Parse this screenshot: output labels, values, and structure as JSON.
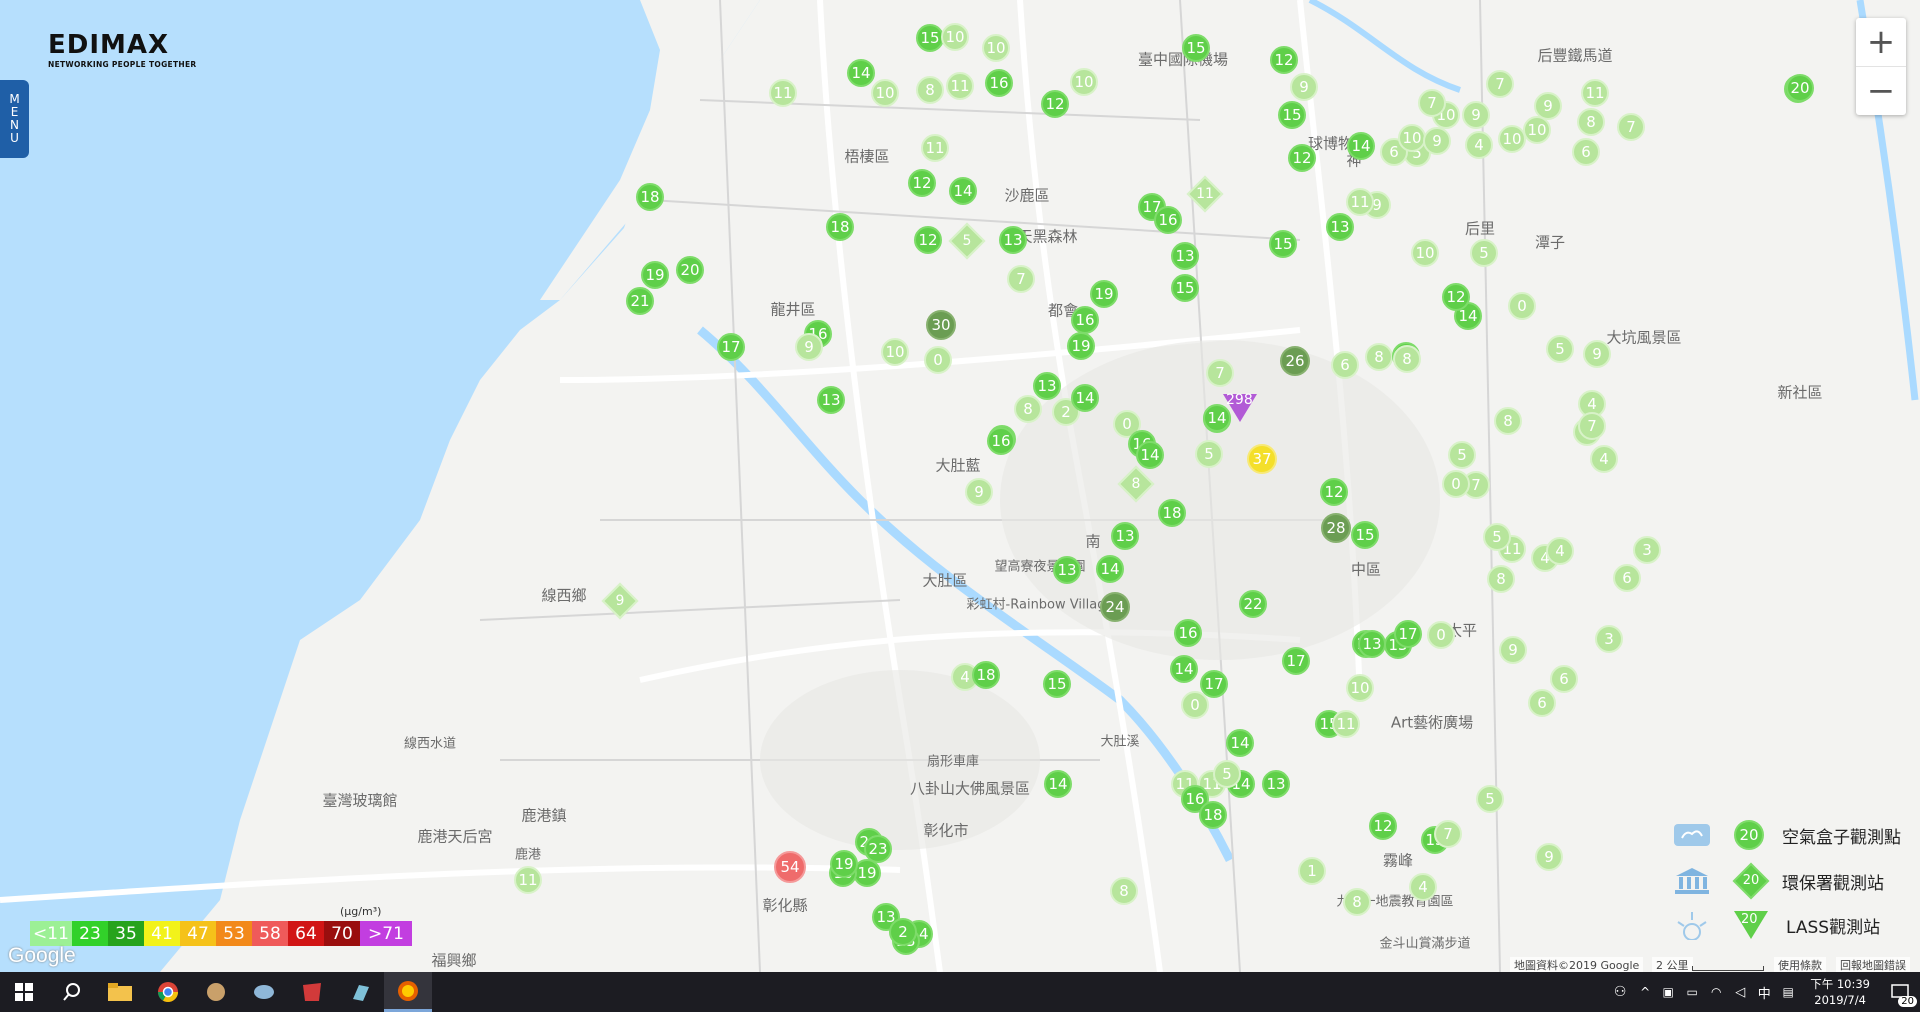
{
  "brand": {
    "name": "EDIMAX",
    "tagline": "NETWORKING PEOPLE TOGETHER"
  },
  "menu_label": "MENU",
  "zoom": {
    "in": "+",
    "out": "−"
  },
  "places": [
    {
      "label": "梧棲區"
    },
    {
      "label": "沙鹿區"
    },
    {
      "label": "龍井區"
    },
    {
      "label": "大肚區"
    },
    {
      "label": "大肚藍"
    },
    {
      "label": "線西鄉"
    },
    {
      "label": "鹿港鎮"
    },
    {
      "label": "鹿港天后宮"
    },
    {
      "label": "臺灣玻璃館"
    },
    {
      "label": "彰化市"
    },
    {
      "label": "彰化縣"
    },
    {
      "label": "福興鄉"
    },
    {
      "label": "都會"
    },
    {
      "label": "南"
    },
    {
      "label": "中區"
    },
    {
      "label": "太平"
    },
    {
      "label": "大坑風景區"
    },
    {
      "label": "新社區"
    },
    {
      "label": "臺中國際機場"
    },
    {
      "label": "后里"
    },
    {
      "label": "九天黑森林"
    },
    {
      "label": "望高寮夜景公園"
    },
    {
      "label": "彩虹村-Rainbow Village"
    },
    {
      "label": "八卦山大佛風景區"
    },
    {
      "label": "九二一地震教育園區"
    },
    {
      "label": "金斗山賞滿步道"
    },
    {
      "label": "線西水道"
    },
    {
      "label": "鹿港"
    },
    {
      "label": "扇形車庫"
    },
    {
      "label": "大肚溪"
    },
    {
      "label": "后豐鐵馬道"
    },
    {
      "label": "潭子"
    },
    {
      "label": "球博物館"
    },
    {
      "label": "神"
    },
    {
      "label": "Art藝術廣場"
    },
    {
      "label": "霧峰"
    }
  ],
  "markers": [
    {
      "v": "15",
      "t": "mid"
    },
    {
      "v": "10",
      "t": "light"
    },
    {
      "v": "10",
      "t": "light"
    },
    {
      "v": "11",
      "t": "light"
    },
    {
      "v": "14",
      "t": "mid"
    },
    {
      "v": "10",
      "t": "light"
    },
    {
      "v": "8",
      "t": "light"
    },
    {
      "v": "11",
      "t": "light"
    },
    {
      "v": "16",
      "t": "mid"
    },
    {
      "v": "10",
      "t": "light"
    },
    {
      "v": "12",
      "t": "mid"
    },
    {
      "v": "15",
      "t": "mid"
    },
    {
      "v": "12",
      "t": "mid"
    },
    {
      "v": "9",
      "t": "light"
    },
    {
      "v": "15",
      "t": "mid"
    },
    {
      "v": "11",
      "t": "light"
    },
    {
      "v": "18",
      "t": "mid"
    },
    {
      "v": "12",
      "t": "mid"
    },
    {
      "v": "14",
      "t": "mid"
    },
    {
      "v": "18",
      "t": "mid"
    },
    {
      "v": "12",
      "t": "mid"
    },
    {
      "v": "13",
      "t": "mid"
    },
    {
      "v": "7",
      "t": "light"
    },
    {
      "v": "19",
      "t": "mid"
    },
    {
      "v": "20",
      "t": "mid"
    },
    {
      "v": "21",
      "t": "mid"
    },
    {
      "v": "16",
      "t": "mid"
    },
    {
      "v": "17",
      "t": "mid"
    },
    {
      "v": "9",
      "t": "light"
    },
    {
      "v": "13",
      "t": "mid"
    },
    {
      "v": "30",
      "t": "dark"
    },
    {
      "v": "10",
      "t": "light"
    },
    {
      "v": "0",
      "t": "light"
    },
    {
      "v": "19",
      "t": "mid"
    },
    {
      "v": "16",
      "t": "mid"
    },
    {
      "v": "19",
      "t": "mid"
    },
    {
      "v": "17",
      "t": "mid"
    },
    {
      "v": "16",
      "t": "mid"
    },
    {
      "v": "13",
      "t": "mid"
    },
    {
      "v": "15",
      "t": "mid"
    },
    {
      "v": "13",
      "t": "mid"
    },
    {
      "v": "8",
      "t": "light"
    },
    {
      "v": "2",
      "t": "light"
    },
    {
      "v": "14",
      "t": "mid"
    },
    {
      "v": "12",
      "t": "mid"
    },
    {
      "v": "9",
      "t": "light"
    },
    {
      "v": "16",
      "t": "mid"
    },
    {
      "v": "7",
      "t": "light"
    },
    {
      "v": "14",
      "t": "mid"
    },
    {
      "v": "0",
      "t": "light"
    },
    {
      "v": "16",
      "t": "mid"
    },
    {
      "v": "14",
      "t": "mid"
    },
    {
      "v": "26",
      "t": "dark"
    },
    {
      "v": "6",
      "t": "light"
    },
    {
      "v": "8",
      "t": "light"
    },
    {
      "v": "16",
      "t": "mid"
    },
    {
      "v": "14",
      "t": "mid"
    },
    {
      "v": "5",
      "t": "light"
    },
    {
      "v": "37",
      "t": "yellow"
    },
    {
      "v": "12",
      "t": "mid"
    },
    {
      "v": "28",
      "t": "dark"
    },
    {
      "v": "15",
      "t": "mid"
    },
    {
      "v": "18",
      "t": "mid"
    },
    {
      "v": "13",
      "t": "mid"
    },
    {
      "v": "14",
      "t": "mid"
    },
    {
      "v": "13",
      "t": "mid"
    },
    {
      "v": "24",
      "t": "dark"
    },
    {
      "v": "22",
      "t": "mid"
    },
    {
      "v": "16",
      "t": "mid"
    },
    {
      "v": "14",
      "t": "mid"
    },
    {
      "v": "17",
      "t": "mid"
    },
    {
      "v": "0",
      "t": "light"
    },
    {
      "v": "17",
      "t": "mid"
    },
    {
      "v": "12",
      "t": "mid"
    },
    {
      "v": "13",
      "t": "mid"
    },
    {
      "v": "10",
      "t": "light"
    },
    {
      "v": "15",
      "t": "mid"
    },
    {
      "v": "11",
      "t": "light"
    },
    {
      "v": "14",
      "t": "mid"
    },
    {
      "v": "4",
      "t": "light"
    },
    {
      "v": "18",
      "t": "mid"
    },
    {
      "v": "15",
      "t": "mid"
    },
    {
      "v": "14",
      "t": "mid"
    },
    {
      "v": "14",
      "t": "mid"
    },
    {
      "v": "11",
      "t": "light"
    },
    {
      "v": "11",
      "t": "light"
    },
    {
      "v": "16",
      "t": "mid"
    },
    {
      "v": "18",
      "t": "mid"
    },
    {
      "v": "13",
      "t": "mid"
    },
    {
      "v": "5",
      "t": "light"
    },
    {
      "v": "12",
      "t": "mid"
    },
    {
      "v": "13",
      "t": "mid"
    },
    {
      "v": "17",
      "t": "mid"
    },
    {
      "v": "0",
      "t": "light"
    },
    {
      "v": "19",
      "t": "mid"
    },
    {
      "v": "18",
      "t": "mid"
    },
    {
      "v": "54",
      "t": "red"
    },
    {
      "v": "8",
      "t": "light"
    },
    {
      "v": "13",
      "t": "mid"
    },
    {
      "v": "14",
      "t": "mid"
    },
    {
      "v": "19",
      "t": "mid"
    },
    {
      "v": "23",
      "t": "mid"
    },
    {
      "v": "20",
      "t": "mid"
    },
    {
      "v": "23",
      "t": "mid"
    },
    {
      "v": "2",
      "t": "mid"
    },
    {
      "v": "11",
      "t": "light"
    },
    {
      "v": "1",
      "t": "light"
    },
    {
      "v": "8",
      "t": "light"
    },
    {
      "v": "15",
      "t": "mid"
    },
    {
      "v": "4",
      "t": "light"
    },
    {
      "v": "7",
      "t": "light"
    },
    {
      "v": "5",
      "t": "light"
    },
    {
      "v": "9",
      "t": "light"
    },
    {
      "v": "6",
      "t": "light"
    },
    {
      "v": "6",
      "t": "light"
    },
    {
      "v": "9",
      "t": "light"
    },
    {
      "v": "11",
      "t": "light"
    },
    {
      "v": "4",
      "t": "light"
    },
    {
      "v": "8",
      "t": "light"
    },
    {
      "v": "3",
      "t": "light"
    },
    {
      "v": "6",
      "t": "light"
    },
    {
      "v": "4",
      "t": "light"
    },
    {
      "v": "9",
      "t": "light"
    },
    {
      "v": "4",
      "t": "light"
    },
    {
      "v": "3",
      "t": "light"
    },
    {
      "v": "9",
      "t": "light"
    },
    {
      "v": "7",
      "t": "light"
    },
    {
      "v": "4",
      "t": "light"
    },
    {
      "v": "8",
      "t": "light"
    },
    {
      "v": "7",
      "t": "light"
    },
    {
      "v": "5",
      "t": "light"
    },
    {
      "v": "0",
      "t": "light"
    },
    {
      "v": "5",
      "t": "light"
    },
    {
      "v": "14",
      "t": "mid"
    },
    {
      "v": "0",
      "t": "light"
    },
    {
      "v": "5",
      "t": "light"
    },
    {
      "v": "5",
      "t": "light"
    },
    {
      "v": "15",
      "t": "mid"
    },
    {
      "v": "20",
      "t": "mid"
    },
    {
      "v": "6",
      "t": "light"
    },
    {
      "v": "10",
      "t": "light"
    },
    {
      "v": "7",
      "t": "light"
    },
    {
      "v": "9",
      "t": "light"
    },
    {
      "v": "10",
      "t": "light"
    },
    {
      "v": "4",
      "t": "light"
    },
    {
      "v": "10",
      "t": "light"
    },
    {
      "v": "11",
      "t": "light"
    },
    {
      "v": "8",
      "t": "light"
    },
    {
      "v": "7",
      "t": "light"
    },
    {
      "v": "9",
      "t": "light"
    },
    {
      "v": "7",
      "t": "light"
    },
    {
      "v": "5",
      "t": "light"
    },
    {
      "v": "6",
      "t": "light"
    },
    {
      "v": "10",
      "t": "light"
    },
    {
      "v": "9",
      "t": "light"
    },
    {
      "v": "13",
      "t": "mid"
    },
    {
      "v": "14",
      "t": "mid"
    },
    {
      "v": "12",
      "t": "mid"
    },
    {
      "v": "15",
      "t": "mid"
    },
    {
      "v": "9",
      "t": "light"
    },
    {
      "v": "11",
      "t": "light"
    },
    {
      "v": "10",
      "t": "light"
    },
    {
      "v": "12",
      "t": "mid"
    },
    {
      "v": "8",
      "t": "light"
    }
  ],
  "special_markers": {
    "triangle_value": "298",
    "diamonds": [
      "11",
      "5",
      "9",
      "8"
    ]
  },
  "scale": [
    {
      "label": "<11",
      "color": "#9cf095",
      "text": "#fff"
    },
    {
      "label": "23",
      "color": "#32d12a",
      "text": "#fff"
    },
    {
      "label": "35",
      "color": "#26a31c",
      "text": "#fff"
    },
    {
      "label": "41",
      "color": "#f2f21a",
      "text": "#fff"
    },
    {
      "label": "47",
      "color": "#f5c21a",
      "text": "#fff"
    },
    {
      "label": "53",
      "color": "#f2891a",
      "text": "#fff"
    },
    {
      "label": "58",
      "color": "#ef5a5a",
      "text": "#fff"
    },
    {
      "label": "64",
      "color": "#d11515",
      "text": "#fff"
    },
    {
      "label": "70",
      "color": "#9a0e0e",
      "text": "#fff"
    },
    {
      "label": ">71",
      "color": "#c23ee0",
      "text": "#fff"
    }
  ],
  "unit": "(μg/m³)",
  "google": "Google",
  "legend": [
    {
      "value": "20",
      "label": "空氣盒子觀測點",
      "icon": "cloud-box-icon"
    },
    {
      "value": "20",
      "label": "環保署觀測站",
      "icon": "government-building-icon"
    },
    {
      "value": "20",
      "label": "LASS觀測站",
      "icon": "sun-icon"
    }
  ],
  "attribution": {
    "map_data": "地圖資料©2019 Google",
    "scale": "2 公里",
    "terms": "使用條款",
    "report": "回報地圖錯誤"
  },
  "taskbar": {
    "time": "下午 10:39",
    "date": "2019/7/4",
    "ime": "中",
    "notification_count": "20"
  }
}
